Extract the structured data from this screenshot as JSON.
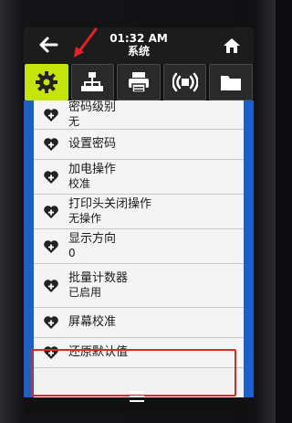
{
  "header": {
    "time": "01:32 AM",
    "title": "系统"
  },
  "tabs": [
    {
      "icon": "gear-icon",
      "active": true
    },
    {
      "icon": "network-icon",
      "active": false
    },
    {
      "icon": "printer-icon",
      "active": false
    },
    {
      "icon": "wireless-icon",
      "active": false
    },
    {
      "icon": "folder-icon",
      "active": false
    }
  ],
  "settings": [
    {
      "label": "密码级别",
      "value": "无"
    },
    {
      "label": "设置密码",
      "value": ""
    },
    {
      "label": "加电操作",
      "value": "校准"
    },
    {
      "label": "打印头关闭操作",
      "value": "无操作"
    },
    {
      "label": "显示方向",
      "value": "0"
    },
    {
      "label": "批量计数器",
      "value": "已启用"
    },
    {
      "label": "屏幕校准",
      "value": ""
    },
    {
      "label": "还原默认值",
      "value": ""
    }
  ],
  "colors": {
    "accent": "#c5e40c",
    "list_background": "#1b5fc8",
    "highlight": "#e52229"
  }
}
